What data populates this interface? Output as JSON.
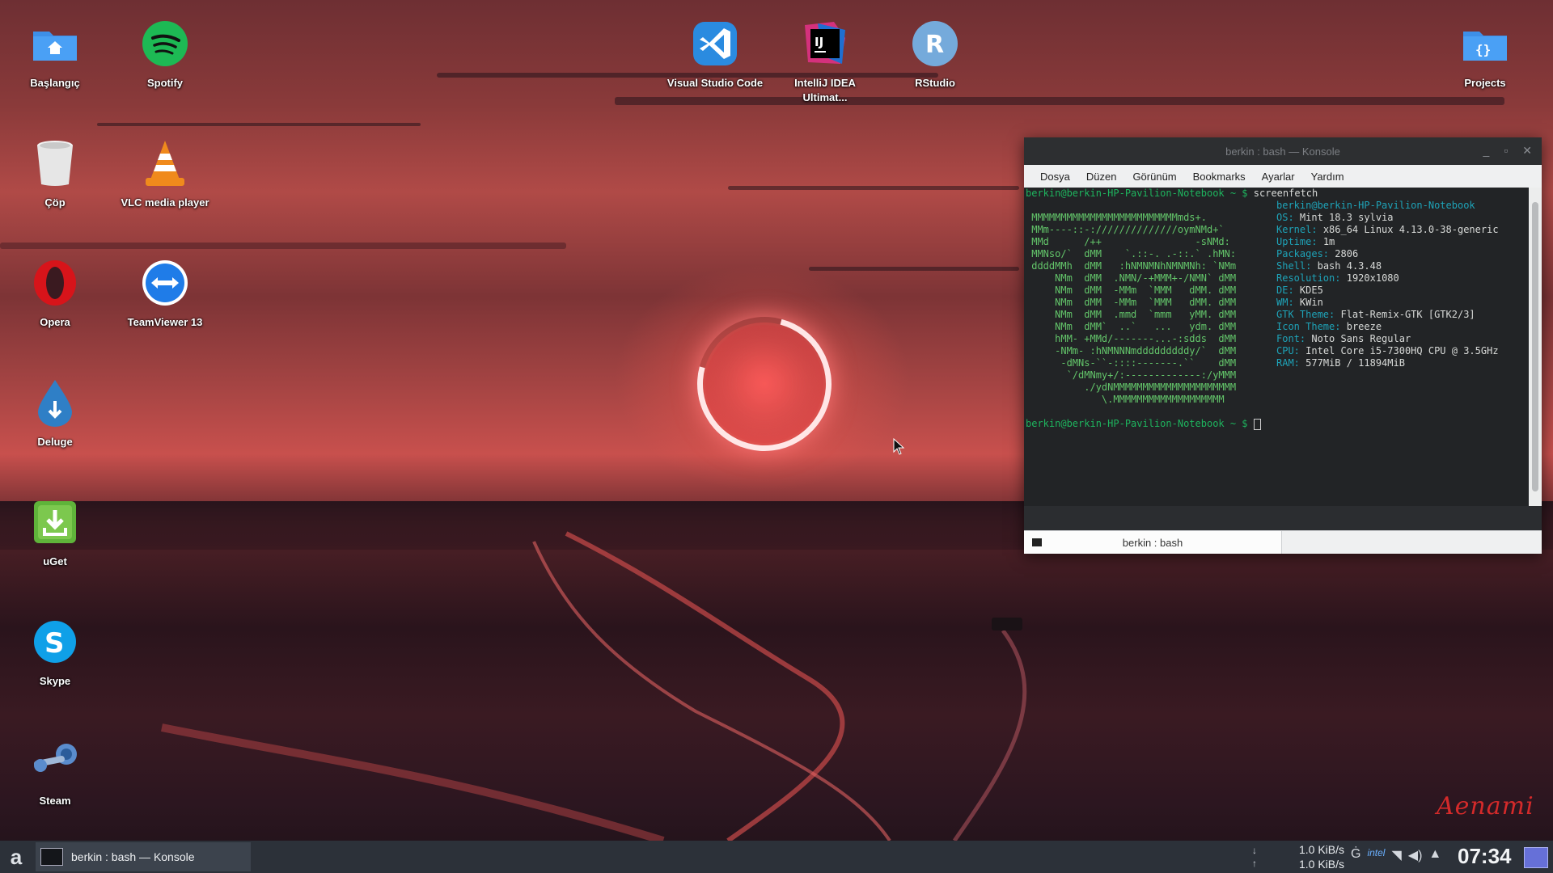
{
  "desktop_icons": [
    {
      "label": "Başlangıç",
      "icon": "home-folder-icon"
    },
    {
      "label": "Spotify",
      "icon": "spotify-icon"
    },
    {
      "label": "Visual Studio Code",
      "icon": "vscode-icon"
    },
    {
      "label": "IntelliJ IDEA Ultimat...",
      "icon": "intellij-icon"
    },
    {
      "label": "RStudio",
      "icon": "rstudio-icon"
    },
    {
      "label": "Projects",
      "icon": "code-folder-icon"
    },
    {
      "label": "Çöp",
      "icon": "trash-icon"
    },
    {
      "label": "VLC media player",
      "icon": "vlc-icon"
    },
    {
      "label": "Opera",
      "icon": "opera-icon"
    },
    {
      "label": "TeamViewer 13",
      "icon": "teamviewer-icon"
    },
    {
      "label": "Deluge",
      "icon": "deluge-icon"
    },
    {
      "label": "uGet",
      "icon": "uget-icon"
    },
    {
      "label": "Skype",
      "icon": "skype-icon"
    },
    {
      "label": "Steam",
      "icon": "steam-icon"
    }
  ],
  "icon_glyphs": {
    "rstudio": "R",
    "intellij": "IJ",
    "projects": "{}"
  },
  "konsole": {
    "title": "berkin : bash — Konsole",
    "menu": [
      "Dosya",
      "Düzen",
      "Görünüm",
      "Bookmarks",
      "Ayarlar",
      "Yardım"
    ],
    "prompt": "berkin@berkin-HP-Pavilion-Notebook ~ $",
    "command": "screenfetch",
    "ascii_lines": [
      "",
      " MMMMMMMMMMMMMMMMMMMMMMMMMmds+.",
      " MMm----::-://////////////oymNMd+`",
      " MMd      /++                -sNMd:",
      " MMNso/`  dMM    `.::-. .-::.` .hMN:",
      " ddddMMh  dMM   :hNMNMNhNMNMNh: `NMm",
      "     NMm  dMM  .NMN/-+MMM+-/NMN` dMM",
      "     NMm  dMM  -MMm  `MMM   dMM. dMM",
      "     NMm  dMM  -MMm  `MMM   dMM. dMM",
      "     NMm  dMM  .mmd  `mmm   yMM. dMM",
      "     NMm  dMM`  ..`   ...   ydm. dMM",
      "     hMM- +MMd/-------...-:sdds  dMM",
      "     -NMm- :hNMNNNmdddddddddy/`  dMM",
      "      -dMNs-``-::::-------.``    dMM",
      "       `/dMNmy+/:-------------:/yMMM",
      "          ./ydNMMMMMMMMMMMMMMMMMMMMM",
      "             \\.MMMMMMMMMMMMMMMMMMM"
    ],
    "info_header": "berkin@berkin-HP-Pavilion-Notebook",
    "info": [
      {
        "k": "OS:",
        "v": "Mint 18.3 sylvia"
      },
      {
        "k": "Kernel:",
        "v": "x86_64 Linux 4.13.0-38-generic"
      },
      {
        "k": "Uptime:",
        "v": "1m"
      },
      {
        "k": "Packages:",
        "v": "2806"
      },
      {
        "k": "Shell:",
        "v": "bash 4.3.48"
      },
      {
        "k": "Resolution:",
        "v": "1920x1080"
      },
      {
        "k": "DE:",
        "v": "KDE5"
      },
      {
        "k": "WM:",
        "v": "KWin"
      },
      {
        "k": "GTK Theme:",
        "v": "Flat-Remix-GTK [GTK2/3]"
      },
      {
        "k": "Icon Theme:",
        "v": "breeze"
      },
      {
        "k": "Font:",
        "v": "Noto Sans Regular"
      },
      {
        "k": "CPU:",
        "v": "Intel Core i5-7300HQ CPU @ 3.5GHz"
      },
      {
        "k": "RAM:",
        "v": "577MiB / 11894MiB"
      }
    ],
    "tab_label": "berkin : bash"
  },
  "taskbar": {
    "task_label": "berkin : bash — Konsole",
    "net_down": "1.0 KiB/s",
    "net_up": "1.0 KiB/s",
    "clock": "07:34"
  },
  "wallpaper_signature": "Aenami"
}
